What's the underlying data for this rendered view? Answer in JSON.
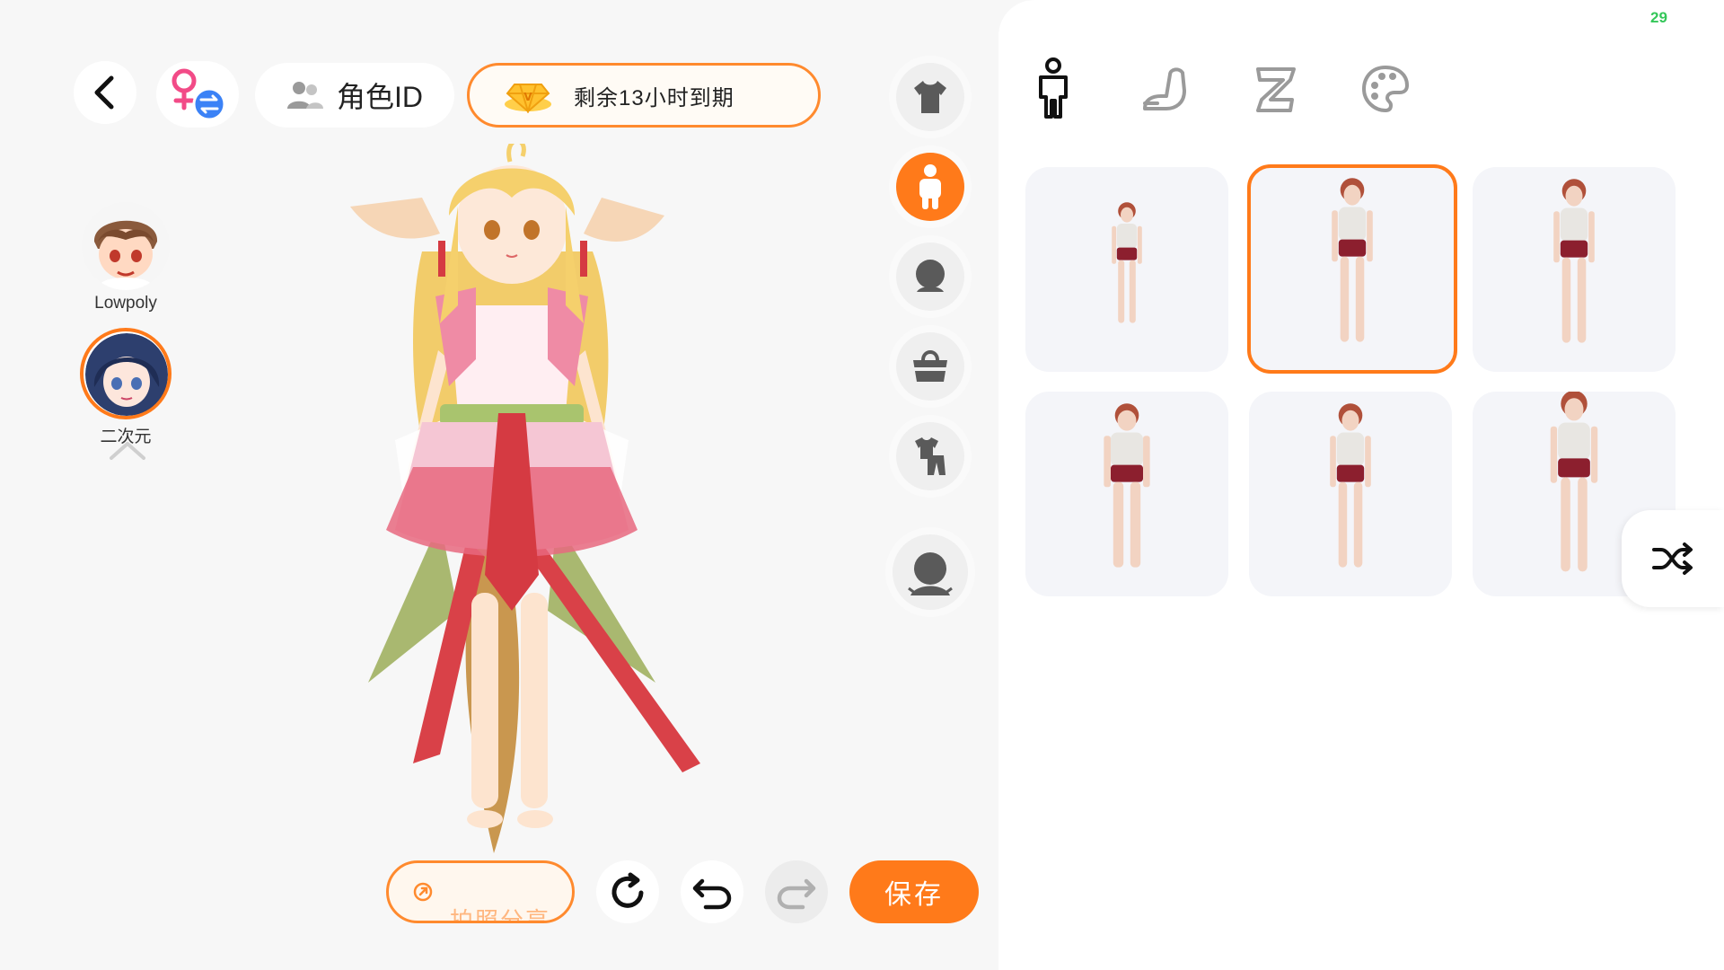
{
  "header": {
    "role_id_label": "角色ID",
    "expiry_label": "剩余13小时到期"
  },
  "styles": {
    "items": [
      {
        "label": "Lowpoly",
        "selected": false
      },
      {
        "label": "二次元",
        "selected": true
      }
    ]
  },
  "category_bar": {
    "items": [
      {
        "icon": "shirt-icon",
        "active": false
      },
      {
        "icon": "body-icon",
        "active": true
      },
      {
        "icon": "head-icon",
        "active": false
      },
      {
        "icon": "bag-icon",
        "active": false
      },
      {
        "icon": "outfit-set-icon",
        "active": false
      },
      {
        "icon": "avatar-preset-icon",
        "active": false
      }
    ]
  },
  "bottom_bar": {
    "share_label": "拍照分享",
    "save_label": "保存"
  },
  "right_panel": {
    "fps": "29",
    "tabs": [
      {
        "icon": "body-shape-icon",
        "active": true
      },
      {
        "icon": "arm-icon",
        "active": false
      },
      {
        "icon": "leg-icon",
        "active": false
      },
      {
        "icon": "palette-icon",
        "active": false
      }
    ],
    "body_presets": {
      "selected_index": 1,
      "count": 6
    }
  },
  "colors": {
    "accent": "#ff7a1a",
    "background_left": "#f7f7f7",
    "background_right": "#ffffff",
    "fps_color": "#34c759",
    "gender_badge": "#3b82f6"
  }
}
